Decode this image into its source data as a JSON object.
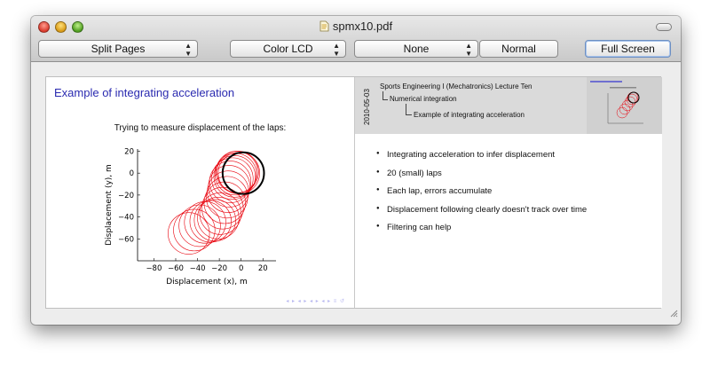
{
  "window": {
    "title": "spmx10.pdf"
  },
  "toolbar": {
    "split_pages": "Split Pages",
    "color_lcd": "Color LCD",
    "none": "None",
    "normal": "Normal",
    "full_screen": "Full Screen"
  },
  "slide": {
    "title": "Example of integrating acceleration",
    "subtitle": "Trying to measure displacement of the laps:",
    "chart_data": {
      "type": "line",
      "title": "",
      "xlabel": "Displacement (x), m",
      "ylabel": "Displacement (y), m",
      "xlim": [
        -95,
        32
      ],
      "ylim": [
        -80,
        22
      ],
      "xticks": [
        "-80",
        "-60",
        "-40",
        "-20",
        "0",
        "20"
      ],
      "yticks": [
        "20",
        "0",
        "-20",
        "-40",
        "-60"
      ],
      "series": [
        {
          "name": "",
          "color": "#e8000b",
          "laps": 20
        },
        {
          "name": "",
          "color": "#000000",
          "laps": 1
        }
      ],
      "lap_centers": [
        [
          -48,
          -55
        ],
        [
          -43,
          -52
        ],
        [
          -38,
          -48
        ],
        [
          -33,
          -45
        ],
        [
          -28,
          -44
        ],
        [
          -24,
          -43
        ],
        [
          -21,
          -41
        ],
        [
          -19,
          -37
        ],
        [
          -17,
          -32
        ],
        [
          -15,
          -27
        ],
        [
          -13,
          -22
        ],
        [
          -12,
          -17
        ],
        [
          -11,
          -12
        ],
        [
          -10,
          -8
        ],
        [
          -8,
          -5
        ],
        [
          -6,
          -3
        ],
        [
          -5,
          -1
        ],
        [
          -4,
          1
        ],
        [
          -3,
          1
        ],
        [
          -2,
          0
        ]
      ],
      "lap_radius": 19,
      "final_lap": {
        "center": [
          2,
          0
        ],
        "radius": 19
      }
    }
  },
  "notes": {
    "date": "2010-05-03",
    "header_line1": "Sports Engineering I (Mechatronics) Lecture Ten",
    "header_line2": "Numerical integration",
    "header_line3": "Example of integrating acceleration",
    "bullets": [
      "Integrating acceleration to infer displacement",
      "20 (small) laps",
      "Each lap, errors accumulate",
      "Displacement following clearly doesn't track over time",
      "Filtering can help"
    ]
  },
  "icons": {
    "document": "document-icon",
    "resize": "resize-grip-icon"
  }
}
